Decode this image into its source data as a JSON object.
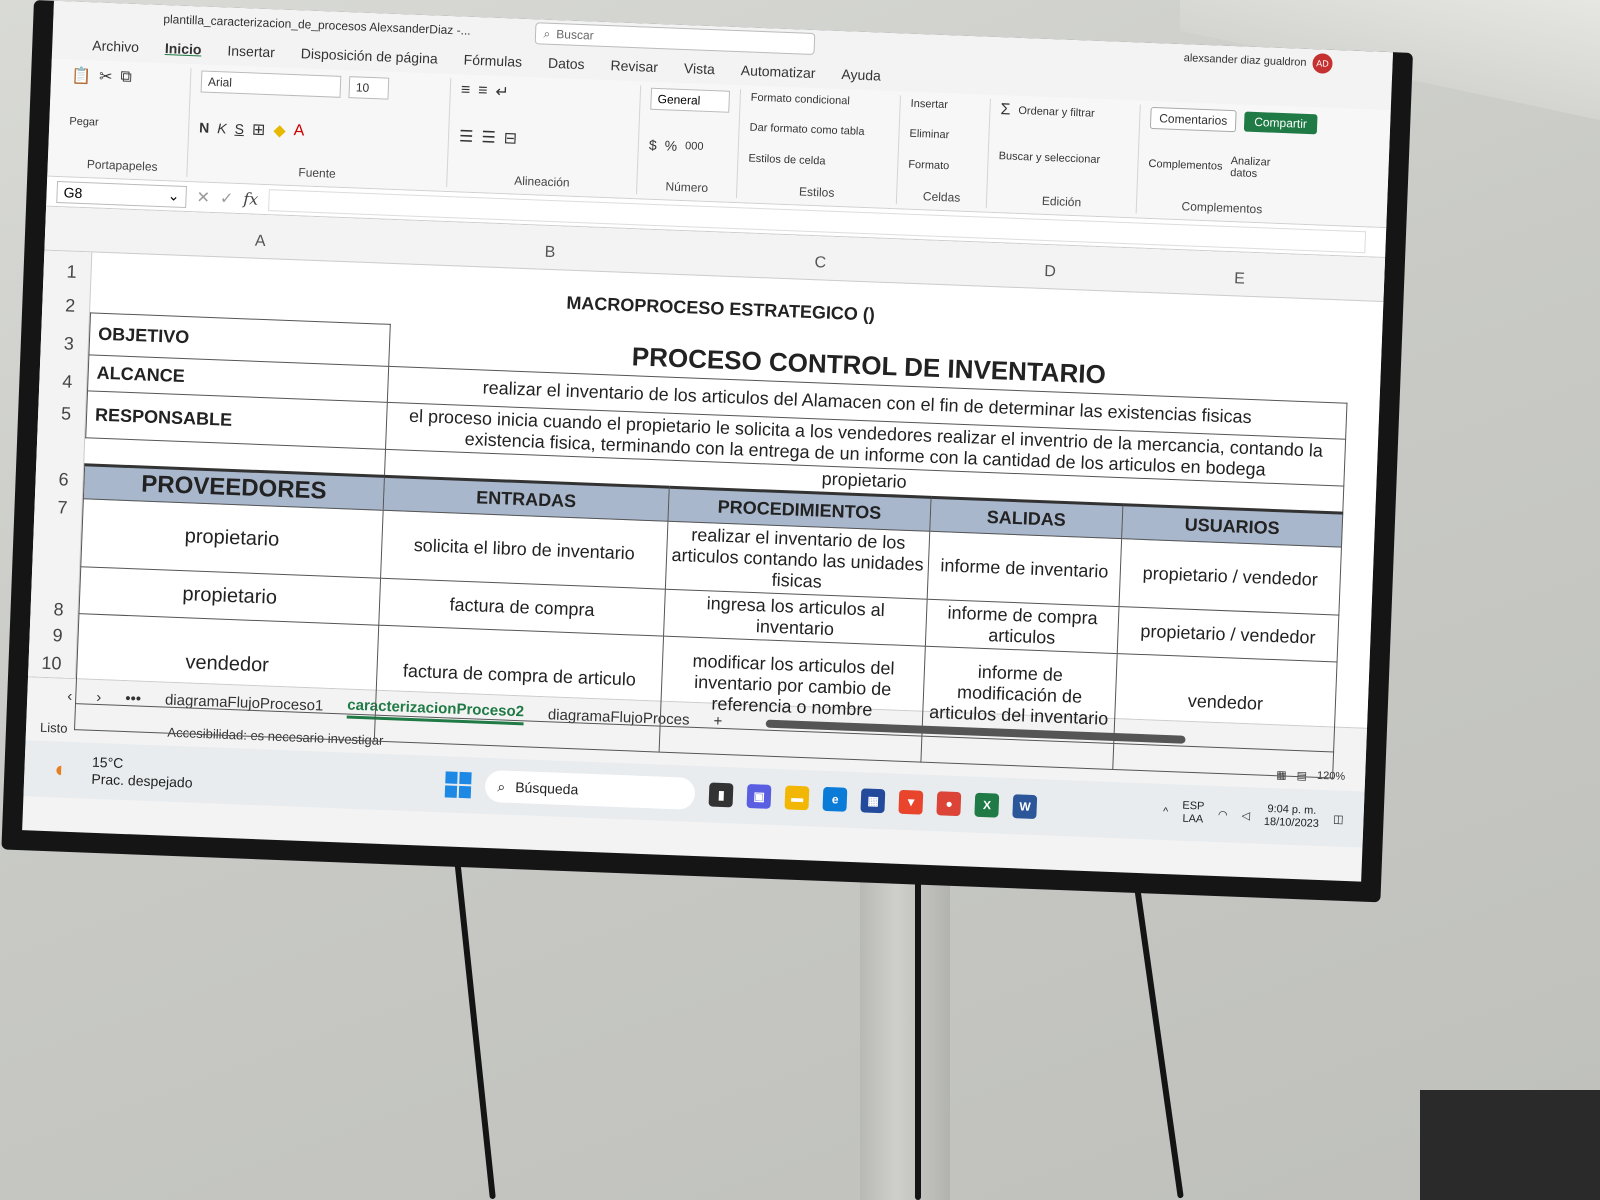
{
  "app": {
    "filename": "plantilla_caracterizacion_de_procesos AlexsanderDiaz -...",
    "search_placeholder": "Buscar",
    "user": "alexsander diaz gualdron",
    "user_initials": "AD"
  },
  "tabs": [
    "Archivo",
    "Inicio",
    "Insertar",
    "Disposición de página",
    "Fórmulas",
    "Datos",
    "Revisar",
    "Vista",
    "Automatizar",
    "Ayuda"
  ],
  "ribbon": {
    "clipboard": {
      "paste": "Pegar",
      "label": "Portapapeles"
    },
    "font": {
      "name": "Arial",
      "size": "10",
      "bold": "N",
      "italic": "K",
      "underline": "S",
      "label": "Fuente"
    },
    "alignment": {
      "label": "Alineación"
    },
    "number": {
      "format": "General",
      "currency": "$",
      "percent": "%",
      "thousands": "000",
      "label": "Número"
    },
    "styles": {
      "conditional": "Formato condicional",
      "as_table": "Dar formato como tabla",
      "cell_styles": "Estilos de celda",
      "label": "Estilos"
    },
    "cells": {
      "insert": "Insertar",
      "delete": "Eliminar",
      "format": "Formato",
      "label": "Celdas"
    },
    "editing": {
      "sort": "Ordenar y filtrar",
      "find": "Buscar y seleccionar",
      "label": "Edición"
    },
    "addins": {
      "complements": "Complementos",
      "analyze": "Analizar datos",
      "label": "Complementos"
    },
    "comments": "Comentarios",
    "share": "Compartir"
  },
  "formula_bar": {
    "cell_ref": "G8",
    "fx": "fx",
    "value": ""
  },
  "columns": [
    "A",
    "B",
    "C",
    "D",
    "E"
  ],
  "rows": [
    "1",
    "2",
    "3",
    "4",
    "5",
    "6",
    "7",
    "8",
    "9",
    "10"
  ],
  "sheet": {
    "title1": "MACROPROCESO ESTRATEGICO  ()",
    "title2": "PROCESO CONTROL DE INVENTARIO",
    "objetivo_label": "OBJETIVO",
    "objetivo": "realizar el inventario de los articulos del Alamacen  con el fin de determinar las existencias fisicas",
    "alcance_label": "ALCANCE",
    "alcance": "el proceso inicia cuando el propietario le solicita a los vendedores realizar el inventrio de la mercancia,  contando la existencia fisica, terminando con la entrega de un informe con la cantidad de los articulos en bodega",
    "responsable_label": "RESPONSABLE",
    "responsable": "propietario",
    "headers": [
      "PROVEEDORES",
      "ENTRADAS",
      "PROCEDIMIENTOS",
      "SALIDAS",
      "USUARIOS"
    ],
    "table": [
      [
        "propietario",
        "solicita el libro de inventario",
        "realizar el inventario de los articulos contando las unidades fisicas",
        "informe de inventario",
        "propietario / vendedor"
      ],
      [
        "propietario",
        "factura de compra",
        "ingresa los articulos al inventario",
        "informe de compra articulos",
        "propietario / vendedor"
      ],
      [
        "vendedor",
        "factura de compra de articulo",
        "modificar los articulos del inventario por cambio de referencia o nombre",
        "informe de modificación  de articulos del inventario",
        "vendedor"
      ]
    ]
  },
  "sheet_tabs": [
    "diagramaFlujoProceso1",
    "caracterizacionProceso2",
    "diagramaFlujoProces"
  ],
  "status": {
    "ready": "Listo",
    "accessibility": "Accesibilidad: es necesario investigar",
    "zoom": "120%"
  },
  "taskbar": {
    "temp": "15°C",
    "weather": "Prac. despejado",
    "search": "Búsqueda",
    "lang1": "ESP",
    "lang2": "LAA",
    "time": "9:04 p. m.",
    "date": "18/10/2023"
  },
  "colors": {
    "excel_green": "#1f7a45",
    "header_fill": "#a9b7cc"
  }
}
